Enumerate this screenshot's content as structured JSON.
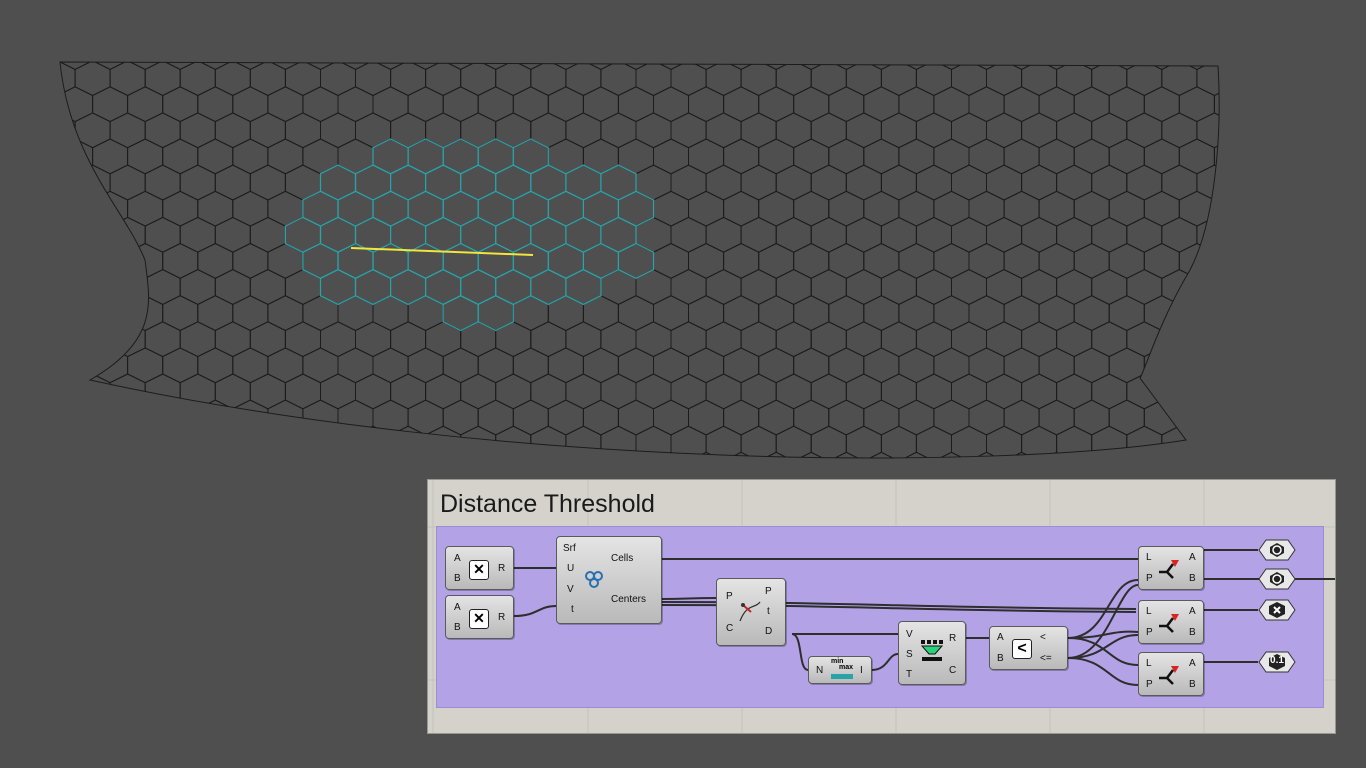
{
  "canvas": {
    "group_title": "Distance Threshold"
  },
  "components": {
    "mult1": {
      "in_a": "A",
      "in_b": "B",
      "out_r": "R"
    },
    "mult2": {
      "in_a": "A",
      "in_b": "B",
      "out_r": "R"
    },
    "hexcells": {
      "in_srf": "Srf",
      "in_u": "U",
      "in_v": "V",
      "in_t": "t",
      "out_cells": "Cells",
      "out_centers": "Centers"
    },
    "closest": {
      "in_p": "P",
      "in_c": "C",
      "out_p": "P",
      "out_t": "t",
      "out_d": "D"
    },
    "bounds": {
      "in_n": "N",
      "out_i": "I",
      "icon_min": "min",
      "icon_max": "max"
    },
    "remap": {
      "in_v": "V",
      "in_s": "S",
      "in_t": "T",
      "out_r": "R",
      "out_c": "C"
    },
    "smaller": {
      "in_a": "A",
      "in_b": "B",
      "out_lt": "<",
      "out_le": "<="
    },
    "dispatch1": {
      "in_l": "L",
      "in_p": "P",
      "out_a": "A",
      "out_b": "B"
    },
    "dispatch2": {
      "in_l": "L",
      "in_p": "P",
      "out_a": "A",
      "out_b": "B"
    },
    "dispatch3": {
      "in_l": "L",
      "in_p": "P",
      "out_a": "A",
      "out_b": "B"
    },
    "number_param": {
      "label": "0.1"
    }
  },
  "colors": {
    "viewport_bg": "#4f4f4f",
    "mesh_line": "#1c1c1c",
    "highlight_cells": "#2aa3a8",
    "selected_curve": "#f2e63a",
    "group_fill": "#b3a3e6",
    "canvas_bg": "#d5d2cc"
  },
  "icons": [
    "multiplication-icon",
    "hexagonal-cells-icon",
    "curve-closest-point-icon",
    "bounds-icon",
    "remap-numbers-icon",
    "smaller-than-icon",
    "dispatch-icon",
    "geometry-param-icon",
    "point-param-icon",
    "number-param-icon"
  ]
}
